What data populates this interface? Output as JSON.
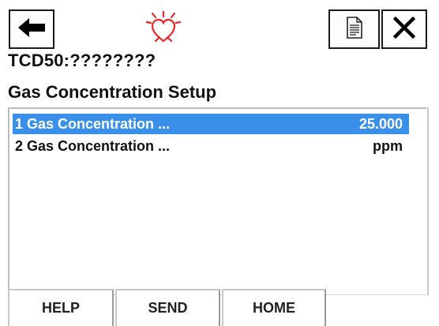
{
  "toolbar": {
    "back_icon": "arrow-left-icon",
    "status_icon": "heart-alarm-icon",
    "status_color": "#e8262b",
    "document_icon": "document-icon",
    "close_icon": "close-icon",
    "close_glyph": "✕"
  },
  "device": {
    "title": "TCD50:????????"
  },
  "page": {
    "title": "Gas Concentration Setup"
  },
  "menu": {
    "items": [
      {
        "label": "1 Gas Concentration ...",
        "value": "25.000",
        "selected": true
      },
      {
        "label": "2 Gas Concentration ...",
        "value": "ppm",
        "selected": false
      }
    ]
  },
  "footer": {
    "help_label": "HELP",
    "send_label": "SEND",
    "home_label": "HOME"
  },
  "colors": {
    "selection": "#3a8fe8",
    "text": "#111111"
  }
}
